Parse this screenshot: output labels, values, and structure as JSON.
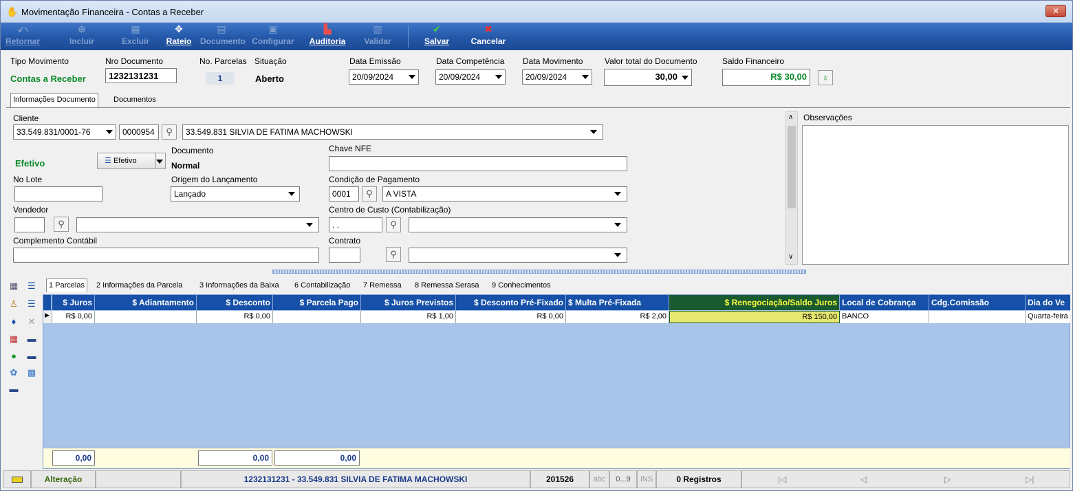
{
  "window": {
    "title": "Movimentação Financeira - Contas a Receber",
    "close_label": "✕"
  },
  "toolbar": {
    "retornar": "Retornar",
    "incluir": "Incluir",
    "excluir": "Excluir",
    "rateio": "Rateio",
    "documento": "Documento",
    "configurar": "Configurar",
    "auditoria": "Auditoria",
    "validar": "Validar",
    "salvar": "Salvar",
    "cancelar": "Cancelar"
  },
  "header": {
    "tipo_label": "Tipo Movimento",
    "tipo_value": "Contas a Receber",
    "nro_label": "Nro Documento",
    "nro_value": "1232131231",
    "parcelas_label": "No. Parcelas",
    "parcelas_value": "1",
    "situacao_label": "Situação",
    "situacao_value": "Aberto",
    "emissao_label": "Data Emissão",
    "emissao_value": "20/09/2024",
    "competencia_label": "Data Competência",
    "competencia_value": "20/09/2024",
    "movimento_label": "Data Movimento",
    "movimento_value": "20/09/2024",
    "valor_label": "Valor total do Documento",
    "valor_value": "30,00",
    "saldo_label": "Saldo Financeiro",
    "saldo_value": "R$ 30,00"
  },
  "tabs_top": [
    "Informações Documento",
    "Documentos"
  ],
  "form": {
    "cliente_label": "Cliente",
    "cliente_cnpj": "33.549.831/0001-76",
    "cliente_code": "0000954",
    "cliente_name": "33.549.831 SILVIA DE FATIMA MACHOWSKI",
    "efetivo_label": "Efetivo",
    "efetivo_btn": "Efetivo",
    "documento_label": "Documento",
    "documento_value": "Normal",
    "chave_label": "Chave NFE",
    "chave_value": "",
    "lote_label": "No Lote",
    "lote_value": "",
    "origem_label": "Origem do Lançamento",
    "origem_value": "Lançado",
    "condicao_label": "Condição de Pagamento",
    "condicao_code": "0001",
    "condicao_value": "A VISTA",
    "vendedor_label": "Vendedor",
    "centro_label": "Centro de Custo (Contabilização)",
    "centro_code": " .  .",
    "complemento_label": "Complemento Contábil",
    "contrato_label": "Contrato",
    "obs_label": "Observações"
  },
  "tabs_bottom": [
    "1 Parcelas",
    "2 Informações da Parcela",
    "3 Informações da Baixa",
    "6 Contabilização",
    "7 Remessa",
    "8 Remessa Serasa",
    "9 Conhecimentos"
  ],
  "grid": {
    "headers": [
      "$ Juros",
      "$ Adiantamento",
      "$ Desconto",
      "$ Parcela Pago",
      "$ Juros Previstos",
      "$ Desconto Pré-Fixado",
      "$ Multa Pré-Fixada",
      "$ Renegociação/Saldo Juros",
      "Local de Cobrança",
      "Cdg.Comissão",
      "Dia do Ve"
    ],
    "row": [
      "R$ 0,00",
      "",
      "R$ 0,00",
      "",
      "R$ 1,00",
      "R$ 0,00",
      "R$ 2,00",
      "R$ 150,00",
      "BANCO",
      "",
      "Quarta-feira"
    ],
    "totals": [
      "0,00",
      "0,00",
      "0,00"
    ]
  },
  "status": {
    "mode": "Alteração",
    "desc": "1232131231 - 33.549.831 SILVIA DE FATIMA MACHOWSKI",
    "code": "201526",
    "abc": "abc",
    "num": "0...9",
    "ins": "INS",
    "registros": "0 Registros",
    "first": "|◁",
    "prev": "◁",
    "next": "▷",
    "last": "▷|"
  },
  "colors": {
    "accent": "#1650a8",
    "green": "#0a8a2a",
    "highlight": "#e8e870"
  }
}
